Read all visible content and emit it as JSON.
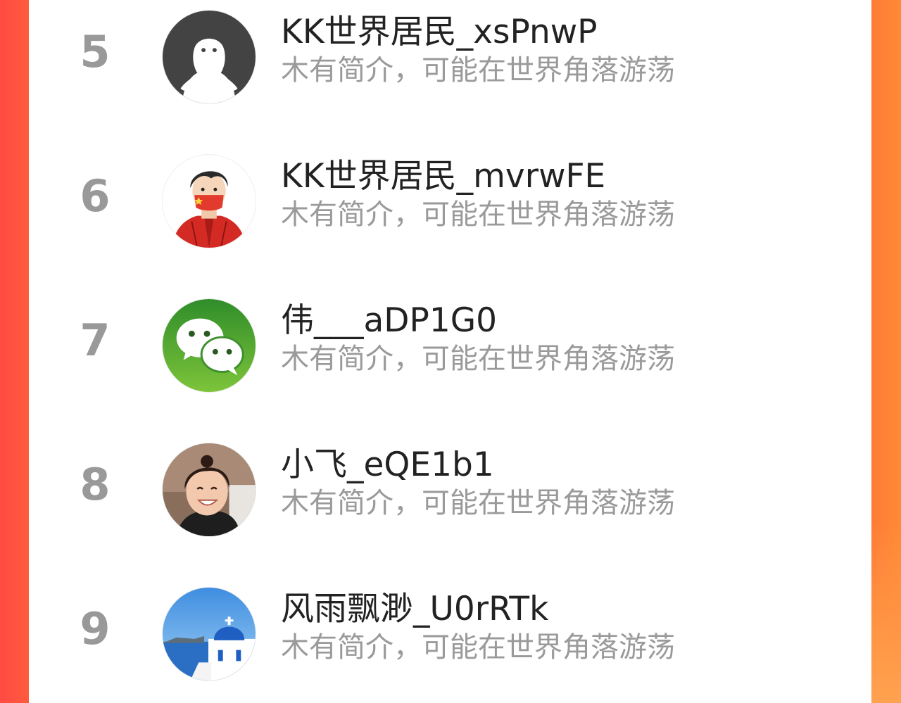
{
  "colors": {
    "background_left": "#ff4a44",
    "background_right": "#ff8a35",
    "panel": "#ffffff",
    "rank_text": "#999999",
    "name_text": "#222222",
    "bio_text": "#9a9a9a"
  },
  "ranking": [
    {
      "rank": "5",
      "name": "KK世界居民_xsPnwP",
      "bio": "木有简介，可能在世界角落游荡",
      "avatar": "default-ghost-avatar"
    },
    {
      "rank": "6",
      "name": "KK世界居民_mvrwFE",
      "bio": "木有简介，可能在世界角落游荡",
      "avatar": "masked-person-avatar"
    },
    {
      "rank": "7",
      "name": "伟___aDP1G0",
      "bio": "木有简介，可能在世界角落游荡",
      "avatar": "wechat-logo-avatar"
    },
    {
      "rank": "8",
      "name": "小飞_eQE1b1",
      "bio": "木有简介，可能在世界角落游荡",
      "avatar": "child-photo-avatar"
    },
    {
      "rank": "9",
      "name": "风雨飘渺_U0rRTk",
      "bio": "木有简介，可能在世界角落游荡",
      "avatar": "santorini-photo-avatar"
    }
  ]
}
